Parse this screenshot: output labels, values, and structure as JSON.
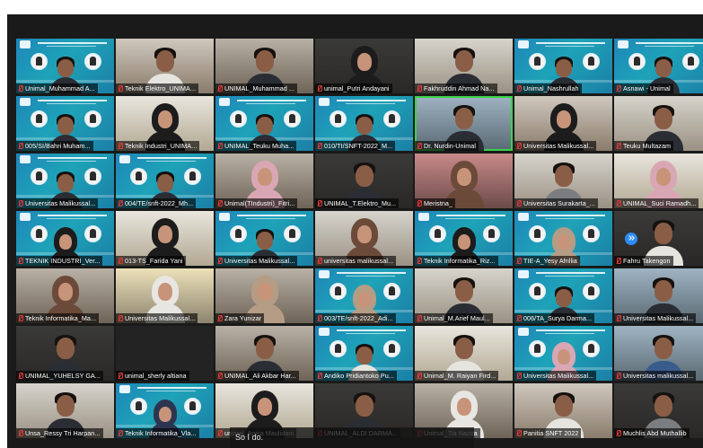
{
  "window": {
    "background": "#1a1a1a",
    "speaking_color": "#3cd24a",
    "banner_color": "#1ea3b8"
  },
  "caption": {
    "text": "So I do."
  },
  "pager": {
    "icon": "chevron-double-right-icon",
    "color": "#2d8cff"
  },
  "rows": [
    [
      "Unimal_Muhammad A...",
      "Teknik Elektro_UNIMA...",
      "UNIMAL_Muhammad ...",
      "unimal_Putri Andayani",
      "Fakhruddin Ahmad Na...",
      "Unimal_Nashrullah",
      "Asnawi - Unimal"
    ],
    [
      "005/SI/Bahri Muham...",
      "Teknik Industri_UNIMA...",
      "UNIMAL_Teuku Muha...",
      "010/TI/SNFT-2022_M...",
      "Dr. Nurdin-Unimal",
      "Universitas Malikussal...",
      "Teuku Multazam"
    ],
    [
      "Universitas Malikussal...",
      "004/TE/snft-2022_Mh...",
      "Unimal(TIndustri)_Fitri...",
      "UNIMAL_T.Elektro_Mu...",
      "Meristna_",
      "Universitas Surakarta_...",
      "UNIMAL_Suci Ramadh..."
    ],
    [
      "TEKNIK INDUSTRI_Ver...",
      "013-TS_Farida Yani",
      "Universitas Malikussal...",
      "universitas malikussal...",
      "Teknik Informatika_Riz...",
      "TIE-A_Yesy Afrillia",
      "Fahru Takengon"
    ],
    [
      "Teknik Informatika_Ma...",
      "Universitas Malikussal...",
      "Zara Yunizar",
      "003/TE/snft-2022_Adi...",
      "Unimal_M.Arief Maul...",
      "006/TA_Surya Darma...",
      "Universitas Malikussal..."
    ],
    [
      "UNIMAL_YUHELSY GA...",
      "unimal_sherly altiana",
      "UNIMAL_Ali Akbar Har...",
      "Andiko Pridiantoko Pu...",
      "Unimal_M. Raiyan Fird...",
      "Universitas Malikussal...",
      "Universitas malikussal..."
    ],
    [
      "Unsa_Ressy Tri Harpan...",
      "Teknik Informatika_Vla...",
      "unimal_Anisa Maulidani",
      "UNIMAL_ALDI DARMA...",
      "Unimal_Tia Nazira",
      "Panitia SNFT 2022",
      "Muchlis Abd Muthallib"
    ]
  ]
}
